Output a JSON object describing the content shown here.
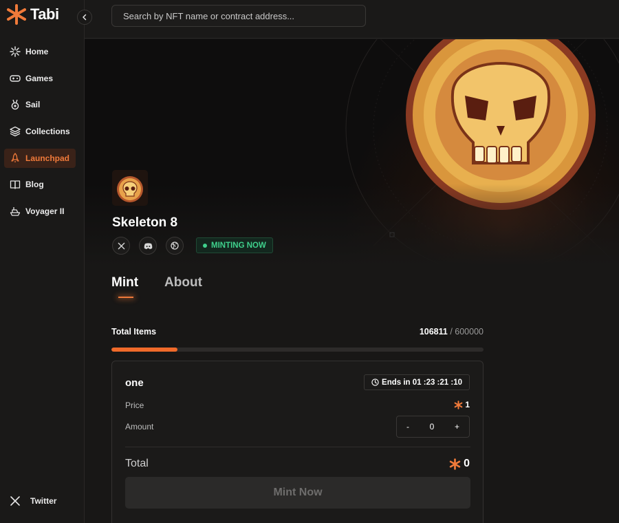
{
  "brand": {
    "name": "Tabi",
    "accent": "#f07a3a"
  },
  "search": {
    "placeholder": "Search by NFT name or contract address..."
  },
  "sidebar": {
    "items": [
      {
        "label": "Home",
        "icon": "sparkle-icon"
      },
      {
        "label": "Games",
        "icon": "gamepad-icon"
      },
      {
        "label": "Sail",
        "icon": "medal-icon"
      },
      {
        "label": "Collections",
        "icon": "layers-icon"
      },
      {
        "label": "Launchpad",
        "icon": "rocket-icon",
        "active": true
      },
      {
        "label": "Blog",
        "icon": "book-icon"
      },
      {
        "label": "Voyager II",
        "icon": "ship-icon"
      }
    ],
    "footer": {
      "label": "Twitter",
      "icon": "x-icon"
    }
  },
  "collection": {
    "name": "Skeleton 8",
    "status": "MINTING NOW",
    "socials": [
      "x-icon",
      "discord-icon",
      "globe-icon"
    ]
  },
  "tabs": [
    {
      "label": "Mint",
      "active": true
    },
    {
      "label": "About",
      "active": false
    }
  ],
  "supply": {
    "label": "Total Items",
    "minted": "106811",
    "separator": " / ",
    "max": "600000",
    "fraction": 0.178
  },
  "mint": {
    "phase": "one",
    "ends_text": "Ends in 01 :23 :21 :10",
    "price_label": "Price",
    "price_value": "1",
    "amount_label": "Amount",
    "amount_minus": "-",
    "amount_value": "0",
    "amount_plus": "+",
    "total_label": "Total",
    "total_value": "0",
    "button": "Mint Now"
  }
}
